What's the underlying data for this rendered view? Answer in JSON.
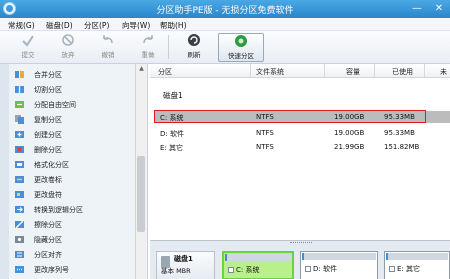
{
  "window": {
    "title": "分区助手PE版 - 无损分区免费软件",
    "minimize": "—",
    "close": "✕"
  },
  "menu": [
    "常规(G)",
    "磁盘(D)",
    "分区(P)",
    "向导(W)",
    "帮助(H)"
  ],
  "toolbar": {
    "submit": "提交",
    "discard": "放弃",
    "undo": "撤销",
    "redo": "重做",
    "refresh": "刷新",
    "quick_partition": "快速分区"
  },
  "sidebar": {
    "items": [
      {
        "label": "合并分区",
        "icon": "merge-icon"
      },
      {
        "label": "切割分区",
        "icon": "split-icon"
      },
      {
        "label": "分配自由空间",
        "icon": "allocate-icon"
      },
      {
        "label": "复制分区",
        "icon": "copy-icon"
      },
      {
        "label": "创建分区",
        "icon": "create-icon"
      },
      {
        "label": "删除分区",
        "icon": "delete-icon"
      },
      {
        "label": "格式化分区",
        "icon": "format-icon"
      },
      {
        "label": "更改卷标",
        "icon": "label-icon"
      },
      {
        "label": "更改盘符",
        "icon": "letter-icon"
      },
      {
        "label": "转换到逻辑分区",
        "icon": "convert-icon"
      },
      {
        "label": "擦除分区",
        "icon": "wipe-icon"
      },
      {
        "label": "隐藏分区",
        "icon": "hide-icon"
      },
      {
        "label": "分区对齐",
        "icon": "align-icon"
      },
      {
        "label": "更改序列号",
        "icon": "serial-icon"
      }
    ]
  },
  "table": {
    "headers": [
      "分区",
      "文件系统",
      "容量",
      "已使用",
      "未"
    ],
    "disk_label": "磁盘1",
    "rows": [
      {
        "partition": "C: 系统",
        "fs": "NTFS",
        "capacity": "19.00GB",
        "used": "95.33MB",
        "selected": true
      },
      {
        "partition": "D: 软件",
        "fs": "NTFS",
        "capacity": "19.00GB",
        "used": "95.33MB",
        "selected": false
      },
      {
        "partition": "E: 其它",
        "fs": "NTFS",
        "capacity": "21.99GB",
        "used": "151.82MB",
        "selected": false
      }
    ]
  },
  "disk_map": {
    "disk_name": "磁盘1",
    "disk_info": "基本 MBR",
    "partitions": [
      {
        "label": "C: 系统",
        "usage": 0.02,
        "selected": true
      },
      {
        "label": "D: 软件",
        "usage": 0.02,
        "selected": false
      },
      {
        "label": "E: 其它",
        "usage": 0.02,
        "selected": false
      }
    ]
  },
  "colors": {
    "titlebar": "#2a86cb",
    "selection_row": "#bcbcbc",
    "highlight_box": "#d62020",
    "selected_partition": "#b9f08c"
  }
}
